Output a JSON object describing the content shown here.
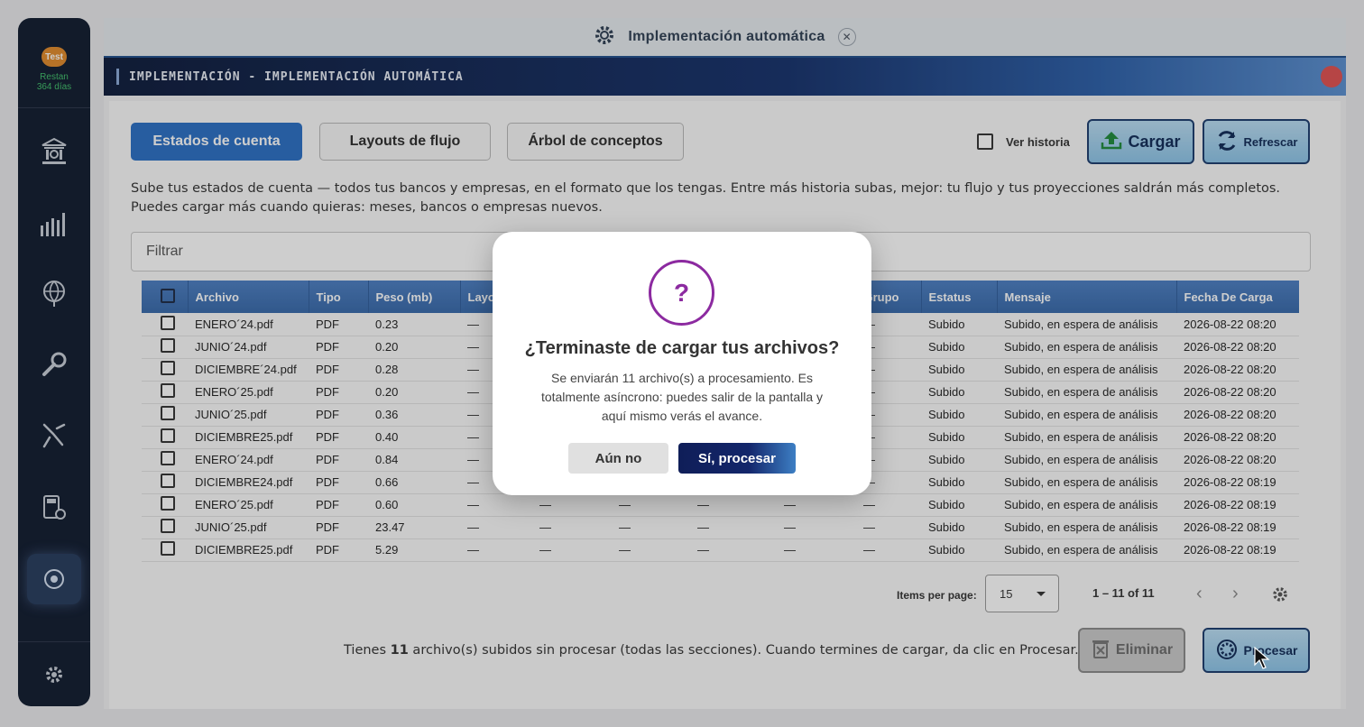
{
  "sidebar": {
    "badge": "Test",
    "days_line1": "Restan",
    "days_line2": "364 días",
    "icons": [
      "bank-icon",
      "bar-chart-icon",
      "globe-icon",
      "wrench-icon",
      "tools-icon",
      "calculator-icon",
      "implementation-icon"
    ]
  },
  "header": {
    "title": "Implementación automática"
  },
  "banner": {
    "text": "IMPLEMENTACIÓN - IMPLEMENTACIÓN AUTOMÁTICA"
  },
  "tabs": [
    {
      "label": "Estados de cuenta",
      "active": true
    },
    {
      "label": "Layouts de flujo",
      "active": false
    },
    {
      "label": "Árbol de conceptos",
      "active": false
    }
  ],
  "toolbar": {
    "history_label": "Ver historia",
    "upload_label": "Cargar",
    "refresh_label": "Refrescar"
  },
  "description": {
    "line1": "Sube tus estados de cuenta — todos tus bancos y empresas, en el formato que los tengas. Entre más historia subas, mejor: tu flujo y tus proyecciones saldrán más completos.",
    "line2": "Puedes cargar más cuando quieras: meses, bancos o empresas nuevos."
  },
  "filter": {
    "placeholder": "Filtrar"
  },
  "table": {
    "columns": [
      "Archivo",
      "Tipo",
      "Peso (mb)",
      "Layout",
      "",
      "",
      "",
      "",
      "Grupo",
      "Estatus",
      "Mensaje",
      "Fecha De Carga"
    ],
    "rows": [
      [
        "ENERO´24.pdf",
        "PDF",
        "0.23",
        "—",
        "—",
        "—",
        "—",
        "—",
        "—",
        "Subido",
        "Subido, en espera de análisis",
        "2026-08-22 08:20"
      ],
      [
        "JUNIO´24.pdf",
        "PDF",
        "0.20",
        "—",
        "—",
        "—",
        "—",
        "—",
        "—",
        "Subido",
        "Subido, en espera de análisis",
        "2026-08-22 08:20"
      ],
      [
        "DICIEMBRE´24.pdf",
        "PDF",
        "0.28",
        "—",
        "—",
        "—",
        "—",
        "—",
        "—",
        "Subido",
        "Subido, en espera de análisis",
        "2026-08-22 08:20"
      ],
      [
        "ENERO´25.pdf",
        "PDF",
        "0.20",
        "—",
        "—",
        "—",
        "—",
        "—",
        "—",
        "Subido",
        "Subido, en espera de análisis",
        "2026-08-22 08:20"
      ],
      [
        "JUNIO´25.pdf",
        "PDF",
        "0.36",
        "—",
        "—",
        "—",
        "—",
        "—",
        "—",
        "Subido",
        "Subido, en espera de análisis",
        "2026-08-22 08:20"
      ],
      [
        "DICIEMBRE25.pdf",
        "PDF",
        "0.40",
        "—",
        "—",
        "—",
        "—",
        "—",
        "—",
        "Subido",
        "Subido, en espera de análisis",
        "2026-08-22 08:20"
      ],
      [
        "ENERO´24.pdf",
        "PDF",
        "0.84",
        "—",
        "—",
        "—",
        "—",
        "—",
        "—",
        "Subido",
        "Subido, en espera de análisis",
        "2026-08-22 08:20"
      ],
      [
        "DICIEMBRE24.pdf",
        "PDF",
        "0.66",
        "—",
        "—",
        "—",
        "—",
        "—",
        "—",
        "Subido",
        "Subido, en espera de análisis",
        "2026-08-22 08:19"
      ],
      [
        "ENERO´25.pdf",
        "PDF",
        "0.60",
        "—",
        "—",
        "—",
        "—",
        "—",
        "—",
        "Subido",
        "Subido, en espera de análisis",
        "2026-08-22 08:19"
      ],
      [
        "JUNIO´25.pdf",
        "PDF",
        "23.47",
        "—",
        "—",
        "—",
        "—",
        "—",
        "—",
        "Subido",
        "Subido, en espera de análisis",
        "2026-08-22 08:19"
      ],
      [
        "DICIEMBRE25.pdf",
        "PDF",
        "5.29",
        "—",
        "—",
        "—",
        "—",
        "—",
        "—",
        "Subido",
        "Subido, en espera de análisis",
        "2026-08-22 08:19"
      ]
    ]
  },
  "pagination": {
    "items_label": "Items per page:",
    "items_value": "15",
    "range": "1 – 11 of 11"
  },
  "footer": {
    "prefix": "Tienes ",
    "count": "11",
    "suffix": " archivo(s) subidos sin procesar (todas las secciones). Cuando termines de cargar, da clic en Procesar.",
    "delete_label": "Eliminar",
    "process_label": "Procesar"
  },
  "modal": {
    "icon": "?",
    "title": "¿Terminaste de cargar tus archivos?",
    "body": "Se enviarán 11 archivo(s) a procesamiento. Es totalmente asíncrono: puedes salir de la pantalla y aquí mismo verás el avance.",
    "cancel_label": "Aún no",
    "confirm_label": "Sí, procesar"
  },
  "colors": {
    "primary": "#2a6fc5",
    "modal_accent": "#8c2aa0",
    "status_days": "#3fbf6a"
  }
}
